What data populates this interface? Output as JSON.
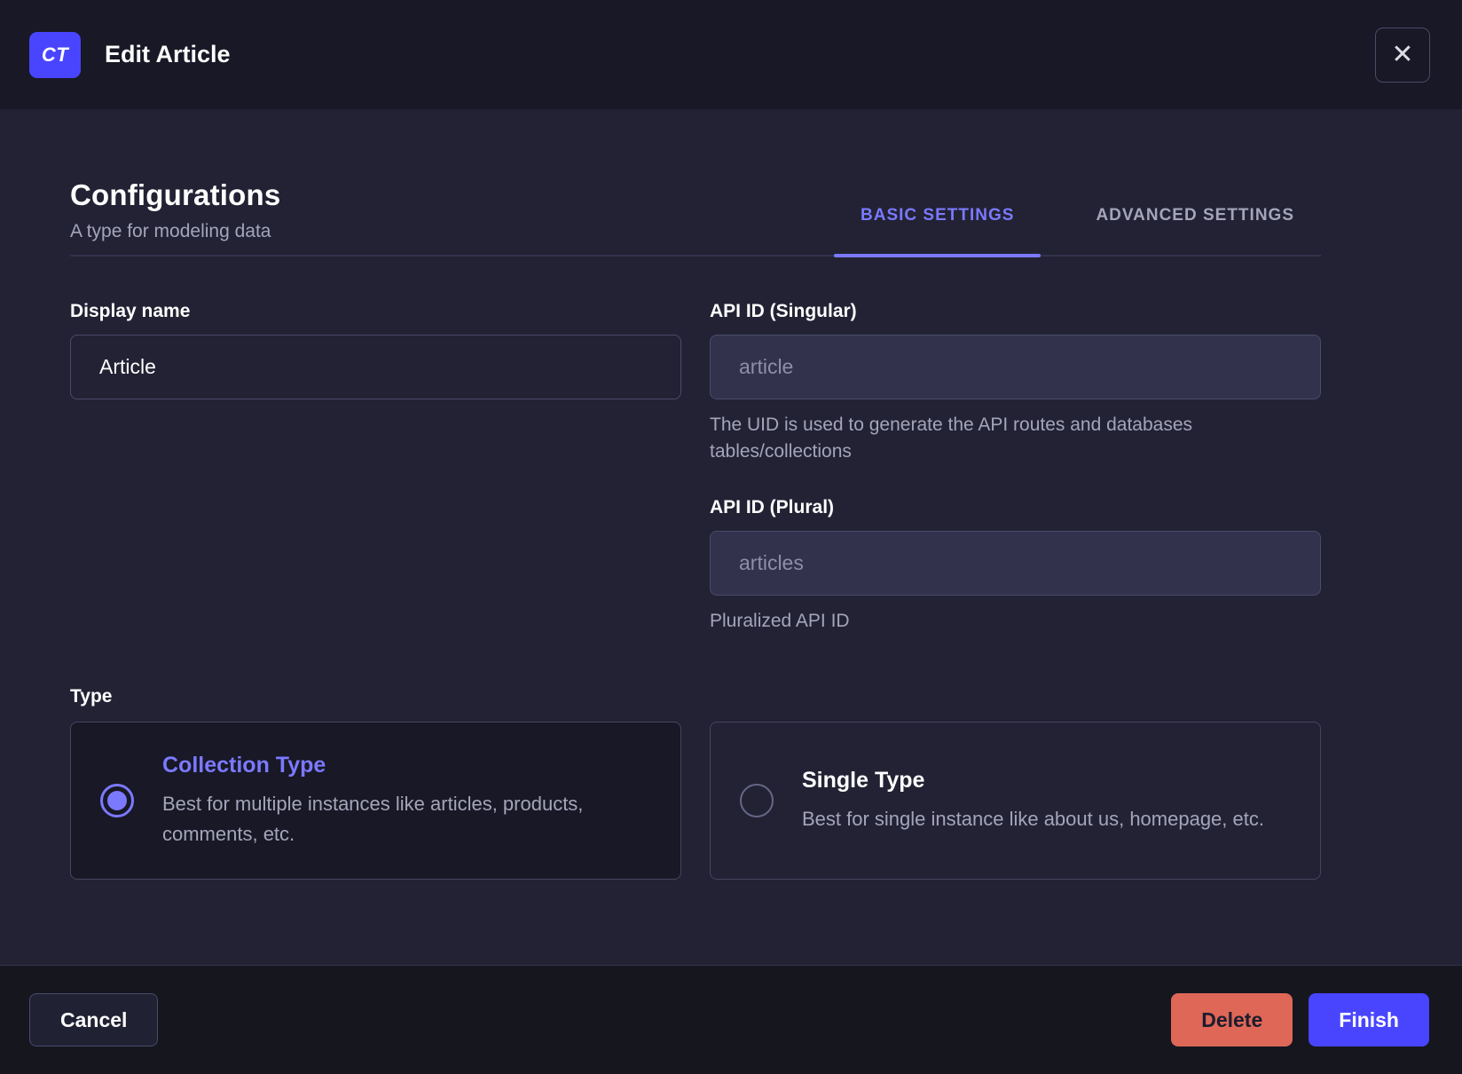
{
  "header": {
    "badge": "CT",
    "title": "Edit Article",
    "close_icon": "✕"
  },
  "body": {
    "heading": "Configurations",
    "subheading": "A type for modeling data",
    "tabs": [
      {
        "label": "BASIC SETTINGS",
        "active": true
      },
      {
        "label": "ADVANCED SETTINGS",
        "active": false
      }
    ],
    "fields": {
      "display_name": {
        "label": "Display name",
        "value": "Article"
      },
      "api_id_singular": {
        "label": "API ID (Singular)",
        "placeholder": "article",
        "hint": "The UID is used to generate the API routes and databases tables/collections"
      },
      "api_id_plural": {
        "label": "API ID (Plural)",
        "placeholder": "articles",
        "hint": "Pluralized API ID"
      }
    },
    "type_section": {
      "label": "Type",
      "options": [
        {
          "title": "Collection Type",
          "description": "Best for multiple instances like articles, products, comments, etc.",
          "selected": true
        },
        {
          "title": "Single Type",
          "description": "Best for single instance like about us, homepage, etc.",
          "selected": false
        }
      ]
    }
  },
  "footer": {
    "cancel_label": "Cancel",
    "delete_label": "Delete",
    "finish_label": "Finish"
  },
  "colors": {
    "accent": "#7b79ff",
    "primary": "#4945ff",
    "danger": "#de6757",
    "body_bg": "#222234",
    "header_bg": "#181826",
    "border": "#4a4a6a",
    "text_muted": "#a5a5ba"
  }
}
